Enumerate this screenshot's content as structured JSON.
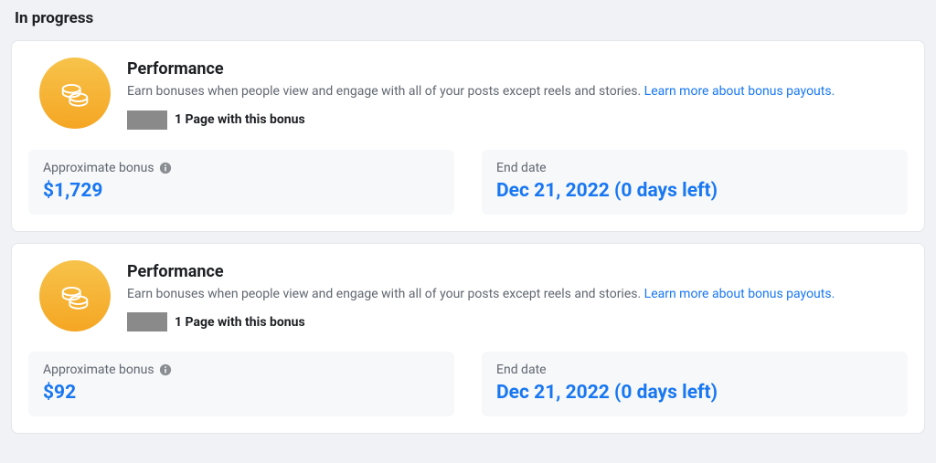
{
  "sectionTitle": "In progress",
  "cards": [
    {
      "title": "Performance",
      "subtitle": "Earn bonuses when people view and engage with all of your posts except reels and stories. ",
      "linkText": "Learn more about bonus payouts.",
      "pageCountText": "1 Page with this bonus",
      "approxBonusLabel": "Approximate bonus",
      "approxBonusValue": "$1,729",
      "endDateLabel": "End date",
      "endDateValue": "Dec 21, 2022 (0 days left)"
    },
    {
      "title": "Performance",
      "subtitle": "Earn bonuses when people view and engage with all of your posts except reels and stories. ",
      "linkText": "Learn more about bonus payouts.",
      "pageCountText": "1 Page with this bonus",
      "approxBonusLabel": "Approximate bonus",
      "approxBonusValue": "$92",
      "endDateLabel": "End date",
      "endDateValue": "Dec 21, 2022 (0 days left)"
    }
  ]
}
